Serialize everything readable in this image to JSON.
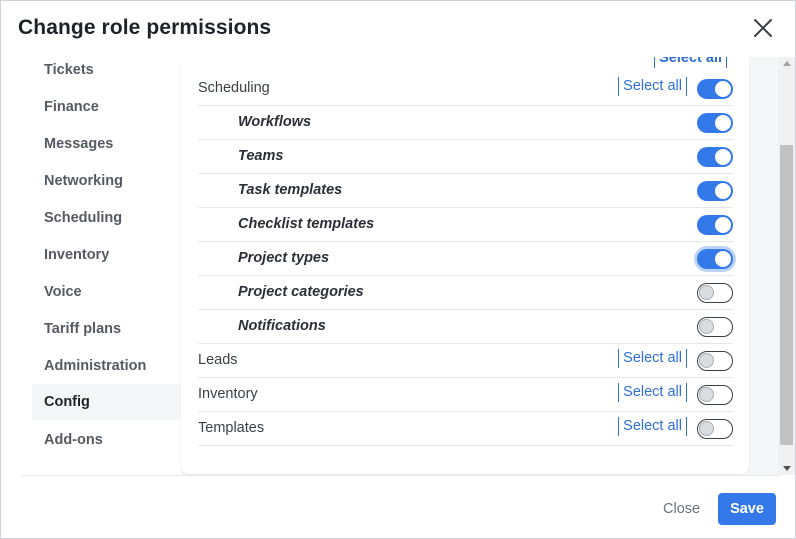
{
  "dialog": {
    "title": "Change role permissions",
    "close_button_label": "Close",
    "save_button_label": "Save"
  },
  "sidebar": {
    "items": [
      {
        "label": "Tickets",
        "active": false
      },
      {
        "label": "Finance",
        "active": false
      },
      {
        "label": "Messages",
        "active": false
      },
      {
        "label": "Networking",
        "active": false
      },
      {
        "label": "Scheduling",
        "active": false
      },
      {
        "label": "Inventory",
        "active": false
      },
      {
        "label": "Voice",
        "active": false
      },
      {
        "label": "Tariff plans",
        "active": false
      },
      {
        "label": "Administration",
        "active": false
      },
      {
        "label": "Config",
        "active": true
      },
      {
        "label": "Add-ons",
        "active": false
      }
    ]
  },
  "permissions": {
    "top_partial_select_all": "Select all",
    "rows": [
      {
        "label": "Scheduling",
        "level": "group",
        "select_all": "Select all",
        "enabled": true
      },
      {
        "label": "Workflows",
        "level": "sub",
        "enabled": true
      },
      {
        "label": "Teams",
        "level": "sub",
        "enabled": true
      },
      {
        "label": "Task templates",
        "level": "sub",
        "enabled": true
      },
      {
        "label": "Checklist templates",
        "level": "sub",
        "enabled": true
      },
      {
        "label": "Project types",
        "level": "sub",
        "enabled": true,
        "focused": true
      },
      {
        "label": "Project categories",
        "level": "sub",
        "enabled": false
      },
      {
        "label": "Notifications",
        "level": "sub",
        "enabled": false
      },
      {
        "label": "Leads",
        "level": "group",
        "select_all": "Select all",
        "enabled": false
      },
      {
        "label": "Inventory",
        "level": "group",
        "select_all": "Select all",
        "enabled": false
      },
      {
        "label": "Templates",
        "level": "group",
        "select_all": "Select all",
        "enabled": false
      }
    ]
  },
  "colors": {
    "accent": "#3479ea",
    "link": "#2f6fd6",
    "text": "#3a3f47"
  },
  "icons": {
    "close": "close-icon",
    "scroll_up": "scroll-up-arrow-icon",
    "scroll_down": "scroll-down-arrow-icon"
  }
}
